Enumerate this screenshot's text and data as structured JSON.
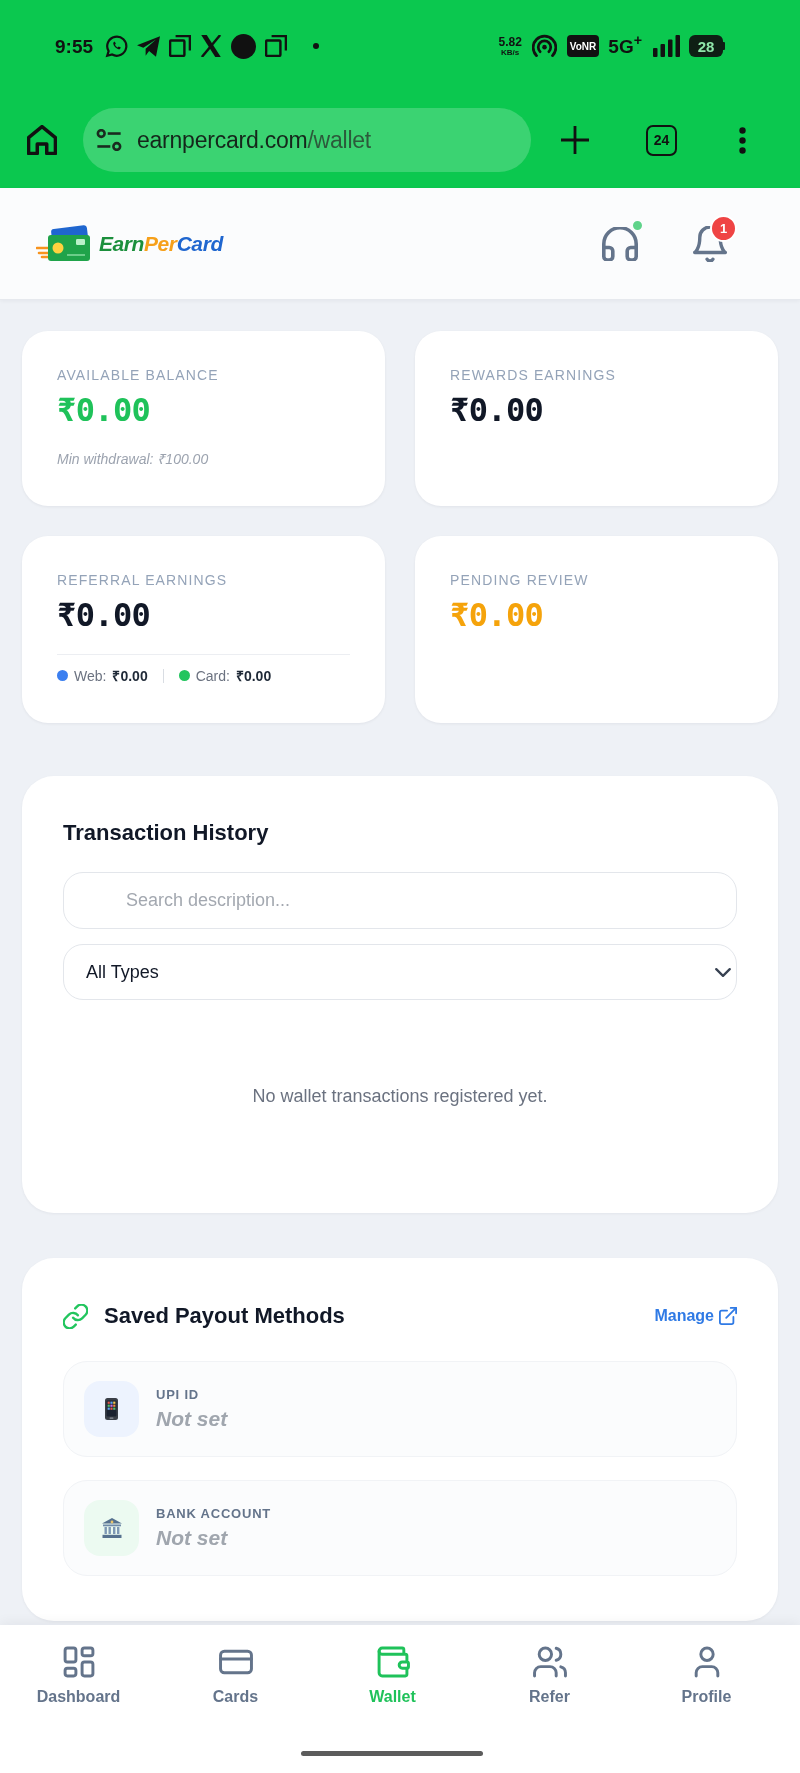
{
  "status_bar": {
    "time": "9:55",
    "speed_value": "5.82",
    "speed_unit": "KB/s",
    "network_badge": "VoNR",
    "network": "5G$^{+}$",
    "battery": "28"
  },
  "browser": {
    "url_host": "earnpercard.com",
    "url_path": "/wallet",
    "tab_count": "24"
  },
  "header": {
    "brand_parts": [
      "Earn",
      "Per",
      "Card"
    ],
    "support_online": true,
    "notification_count": "1"
  },
  "balance_cards": [
    {
      "label": "AVAILABLE BALANCE",
      "amount": "₹0.00",
      "color": "#1fc25a",
      "note": "Min withdrawal: ₹100.00"
    },
    {
      "label": "REWARDS EARNINGS",
      "amount": "₹0.00",
      "color": "#111827"
    },
    {
      "label": "REFERRAL EARNINGS",
      "amount": "₹0.00",
      "color": "#111827",
      "breakdown": [
        {
          "label": "Web:",
          "value": "₹0.00",
          "color": "#3b7ff0"
        },
        {
          "label": "Card:",
          "value": "₹0.00",
          "color": "#22c55e"
        }
      ]
    },
    {
      "label": "PENDING REVIEW",
      "amount": "₹0.00",
      "color": "#f5a30b"
    }
  ],
  "transaction_history": {
    "title": "Transaction History",
    "search": {
      "placeholder": "Search description..."
    },
    "type_filter": {
      "value": "All Types"
    },
    "empty_message": "No wallet transactions registered yet."
  },
  "payout_methods": {
    "title": "Saved Payout Methods",
    "manage_link": "Manage",
    "methods": [
      {
        "kind": "upi",
        "label": "UPI ID",
        "value": "Not set"
      },
      {
        "kind": "bank",
        "label": "BANK ACCOUNT",
        "value": "Not set"
      }
    ]
  },
  "bottom_nav": [
    {
      "label": "Dashboard",
      "selected": false
    },
    {
      "label": "Cards",
      "selected": false
    },
    {
      "label": "Wallet",
      "selected": true
    },
    {
      "label": "Refer",
      "selected": false
    },
    {
      "label": "Profile",
      "selected": false
    }
  ]
}
